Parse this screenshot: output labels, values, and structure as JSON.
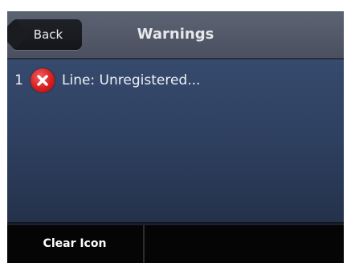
{
  "header": {
    "back_label": "Back",
    "title": "Warnings"
  },
  "warnings": [
    {
      "number": "1",
      "icon": "error-icon",
      "text": "Line: Unregistered..."
    }
  ],
  "softkeys": [
    {
      "label": "Clear Icon"
    },
    {
      "label": ""
    }
  ],
  "colors": {
    "header_bg": "#4f5565",
    "list_bg": "#32466a",
    "softkey_bg": "#050506",
    "error_red": "#d71e1e"
  }
}
